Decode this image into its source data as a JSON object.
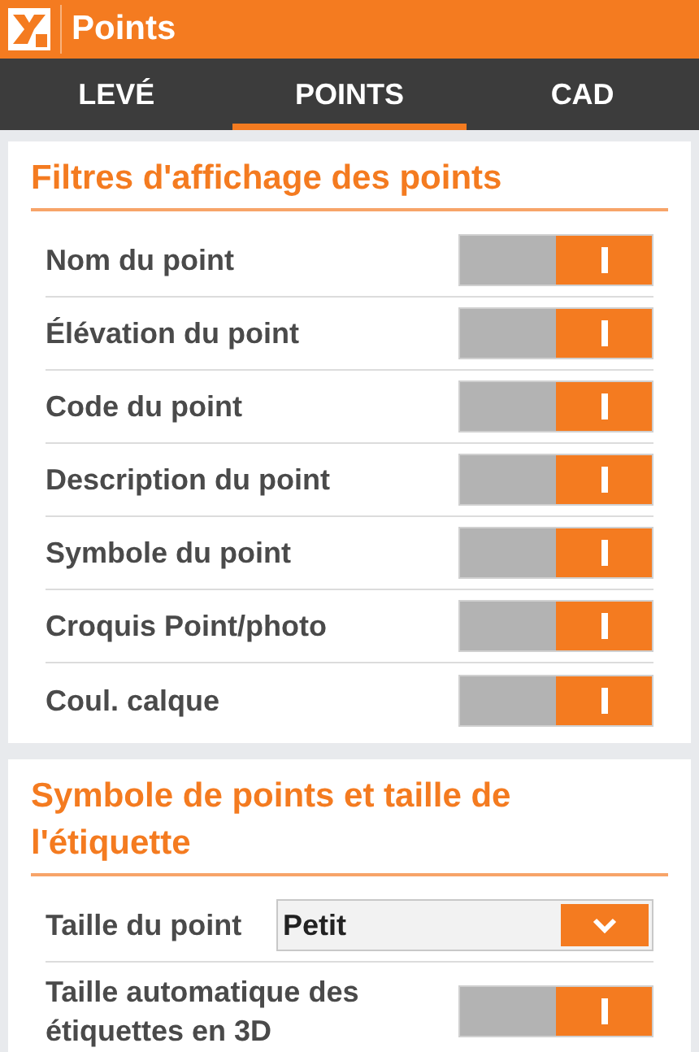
{
  "app_bar": {
    "title": "Points"
  },
  "tabs": [
    {
      "label": "LEVÉ",
      "selected": false
    },
    {
      "label": "POINTS",
      "selected": true
    },
    {
      "label": "CAD",
      "selected": false
    }
  ],
  "sections": [
    {
      "title": "Filtres d'affichage des points",
      "rows": [
        {
          "kind": "toggle",
          "label": "Nom du point",
          "on": true
        },
        {
          "kind": "toggle",
          "label": "Élévation du point",
          "on": true
        },
        {
          "kind": "toggle",
          "label": "Code du point",
          "on": true
        },
        {
          "kind": "toggle",
          "label": "Description du point",
          "on": true
        },
        {
          "kind": "toggle",
          "label": "Symbole du point",
          "on": true
        },
        {
          "kind": "toggle",
          "label": "Croquis Point/photo",
          "on": true
        },
        {
          "kind": "toggle",
          "label": "Coul. calque",
          "on": true
        }
      ]
    },
    {
      "title": "Symbole de points et taille de l'étiquette",
      "rows": [
        {
          "kind": "dropdown",
          "label": "Taille du point",
          "value": "Petit"
        },
        {
          "kind": "toggle",
          "label": "Taille automatique des étiquettes en 3D",
          "on": true
        }
      ]
    }
  ]
}
